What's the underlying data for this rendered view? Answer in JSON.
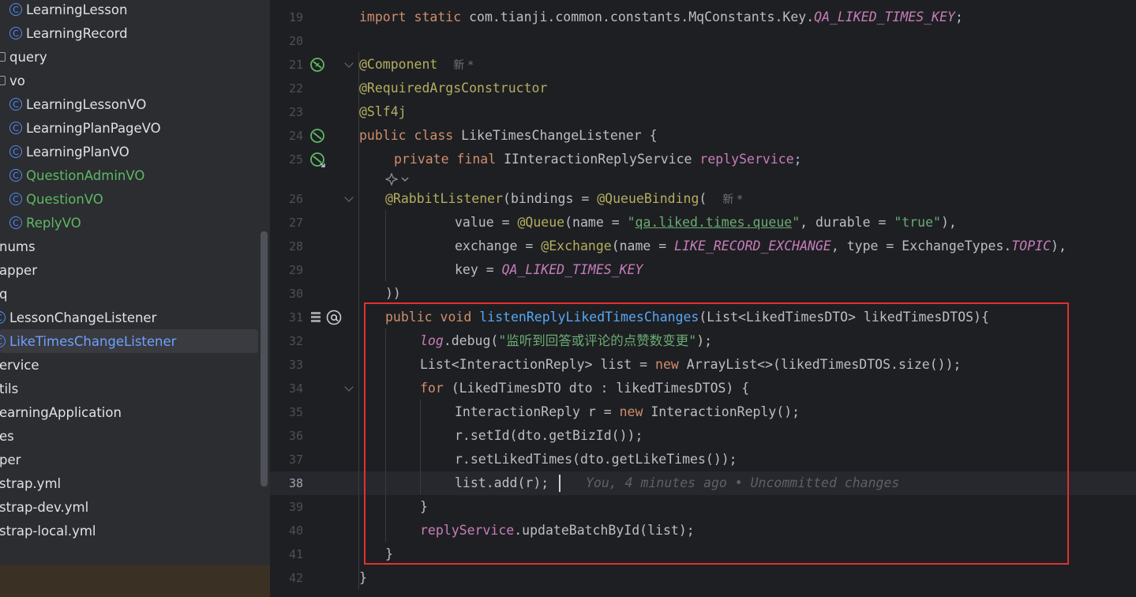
{
  "project_tree": {
    "items": [
      {
        "label": "LearningLesson",
        "kind": "class"
      },
      {
        "label": "LearningRecord",
        "kind": "class"
      },
      {
        "label": "query",
        "kind": "package"
      },
      {
        "label": "vo",
        "kind": "package"
      },
      {
        "label": "LearningLessonVO",
        "kind": "class"
      },
      {
        "label": "LearningPlanPageVO",
        "kind": "class"
      },
      {
        "label": "LearningPlanVO",
        "kind": "class"
      },
      {
        "label": "QuestionAdminVO",
        "kind": "class",
        "status": "new"
      },
      {
        "label": "QuestionVO",
        "kind": "class",
        "status": "new"
      },
      {
        "label": "ReplyVO",
        "kind": "class",
        "status": "new"
      },
      {
        "label": "nums",
        "kind": "folder"
      },
      {
        "label": "apper",
        "kind": "folder"
      },
      {
        "label": "q",
        "kind": "folder"
      },
      {
        "label": "LessonChangeListener",
        "kind": "class"
      },
      {
        "label": "LikeTimesChangeListener",
        "kind": "class",
        "status": "selected"
      },
      {
        "label": "ervice",
        "kind": "folder"
      },
      {
        "label": "tils",
        "kind": "folder"
      },
      {
        "label": "earningApplication",
        "kind": "file"
      },
      {
        "label": "es",
        "kind": "folder"
      },
      {
        "label": "per",
        "kind": "folder"
      },
      {
        "label": "strap.yml",
        "kind": "file"
      },
      {
        "label": "strap-dev.yml",
        "kind": "file"
      },
      {
        "label": "strap-local.yml",
        "kind": "file"
      }
    ]
  },
  "editor": {
    "line_numbers": [
      "19",
      "20",
      "21",
      "22",
      "23",
      "24",
      "25",
      "26",
      "27",
      "28",
      "29",
      "30",
      "31",
      "32",
      "33",
      "34",
      "35",
      "36",
      "37",
      "38",
      "39",
      "40",
      "41",
      "42"
    ],
    "current_line": "38",
    "inlay_new": "新 *",
    "blame_text": "You, 4 minutes ago • Uncommitted changes",
    "code": {
      "l19_import": "import static",
      "l19_pkg": " com.tianji.common.constants.MqConstants.Key.",
      "l19_const": "QA_LIKED_TIMES_KEY",
      "l19_end": ";",
      "l21_ann": "@Component",
      "l22_ann": "@RequiredArgsConstructor",
      "l23_ann": "@Slf4j",
      "l24_kw": "public class",
      "l24_name": " LikeTimesChangeListener {",
      "l25_kw": "private final",
      "l25_type": " IInteractionReplyService ",
      "l25_field": "replyService",
      "l25_end": ";",
      "l26_ann": "@RabbitListener",
      "l26_mid": "(bindings = ",
      "l26_ann2": "@QueueBinding",
      "l26_end": "(",
      "l27_a": "value = ",
      "l27_ann": "@Queue",
      "l27_b": "(name = ",
      "l27_q1": "\"",
      "l27_qname": "qa.liked.times.queue",
      "l27_q2": "\"",
      "l27_c": ", durable = ",
      "l27_str": "\"true\"",
      "l27_d": "),",
      "l28_a": "exchange = ",
      "l28_ann": "@Exchange",
      "l28_b": "(name = ",
      "l28_const": "LIKE_RECORD_EXCHANGE",
      "l28_c": ", type = ExchangeTypes.",
      "l28_const2": "TOPIC",
      "l28_d": "),",
      "l29_a": "key = ",
      "l29_const": "QA_LIKED_TIMES_KEY",
      "l30": "))",
      "l31_kw": "public void",
      "l31_sp": " ",
      "l31_fn": "listenReplyLikedTimesChanges",
      "l31_rest": "(List<LikedTimesDTO> likedTimesDTOS){",
      "l32_log": "log",
      "l32_mid": ".debug(",
      "l32_str": "\"监听到回答或评论的点赞数变更\"",
      "l32_end": ");",
      "l33_a": "List<InteractionReply> list = ",
      "l33_kw": "new",
      "l33_b": " ArrayList<>(likedTimesDTOS.size());",
      "l34_kw": "for",
      "l34_rest": " (LikedTimesDTO dto : likedTimesDTOS) {",
      "l35_a": "InteractionReply r = ",
      "l35_kw": "new",
      "l35_b": " InteractionReply();",
      "l36": "r.setId(dto.getBizId());",
      "l37": "r.setLikedTimes(dto.getLikeTimes());",
      "l38": "list.add(r);",
      "l39": "}",
      "l40_field": "replyService",
      "l40_rest": ".updateBatchById(list);",
      "l41": "}",
      "l42": "}"
    }
  },
  "colors": {
    "keyword": "#cf8e6d",
    "annotation": "#b3ae60",
    "string": "#6aab73",
    "function": "#56a8f5",
    "field_constant": "#c77dbb",
    "highlight_box": "#e03131"
  }
}
